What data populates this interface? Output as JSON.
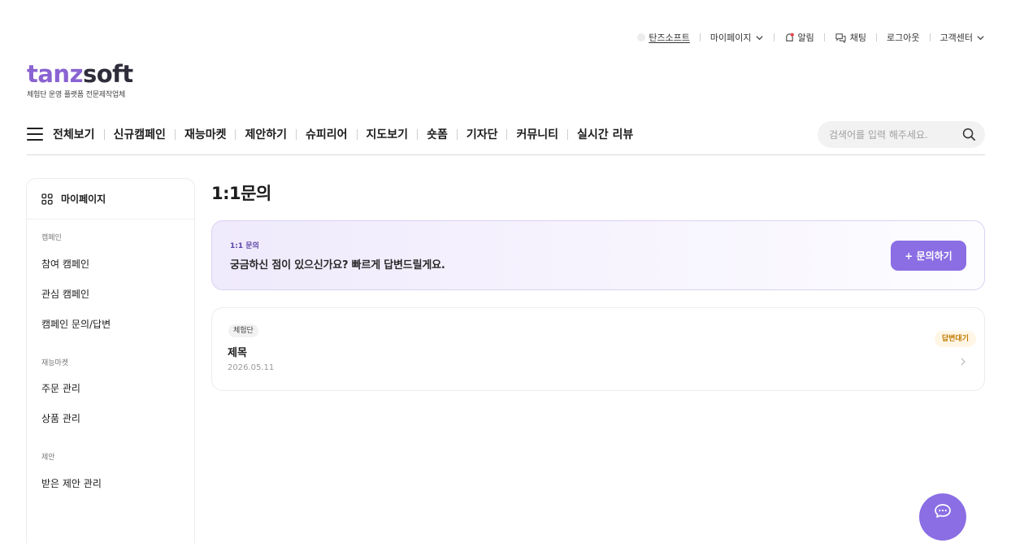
{
  "util_bar": {
    "brand": "탄즈소프트",
    "mypage": "마이페이지",
    "alarm": "알림",
    "chat": "채팅",
    "logout": "로그아웃",
    "support": "고객센터"
  },
  "logo": {
    "word_a": "tanz",
    "word_b": "soft",
    "tagline": "체험단 운영 플랫폼 전문제작업체",
    "brand_color": "#8a63d2"
  },
  "nav": {
    "items": [
      "전체보기",
      "신규캠페인",
      "재능마켓",
      "제안하기",
      "슈피리어",
      "지도보기",
      "숏폼",
      "기자단",
      "커뮤니티",
      "실시간 리뷰"
    ],
    "search_placeholder": "검색어를 입력 해주세요."
  },
  "sidebar": {
    "title": "마이페이지",
    "groups": [
      {
        "label": "캠페인",
        "links": [
          "참여 캠페인",
          "관심 캠페인",
          "캠페인 문의/답변"
        ]
      },
      {
        "label": "재능마켓",
        "links": [
          "주문 관리",
          "상품 관리"
        ]
      },
      {
        "label": "제안",
        "links": [
          "받은 제안 관리"
        ]
      }
    ]
  },
  "main": {
    "title": "1:1문의",
    "banner": {
      "label": "1:1 문의",
      "text": "궁금하신 점이 있으신가요? 빠르게 답변드릴게요.",
      "button": "+ 문의하기",
      "accent": "#8b6ee4"
    },
    "inquiries": [
      {
        "tag": "체험단",
        "title": "제목",
        "date": "2026.05.11",
        "status": "답변대기",
        "status_color": "#c07a00"
      }
    ]
  },
  "icons": {
    "fab": "chat-bubble-icon",
    "search": "search-icon",
    "menu": "hamburger-icon"
  }
}
